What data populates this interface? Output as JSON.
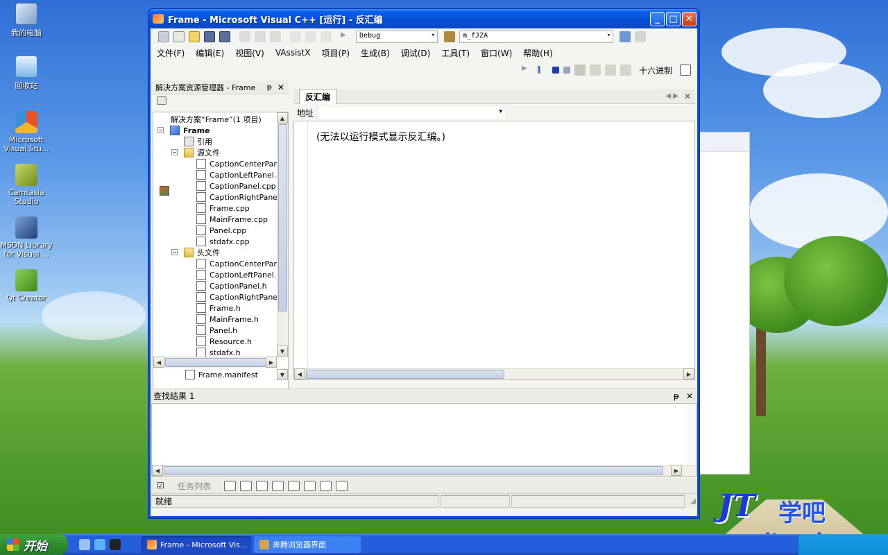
{
  "desktop": {
    "icons": [
      {
        "label": "我的电脑"
      },
      {
        "label": "回收站"
      },
      {
        "label": "Microsoft Visual Stu..."
      },
      {
        "label": "Camtasia Studio"
      },
      {
        "label": "MSDN Library for Visual ..."
      },
      {
        "label": "Qt Creator"
      }
    ]
  },
  "window": {
    "title": "Frame - Microsoft Visual C++ [运行] - 反汇编",
    "minimize": "_",
    "maximize": "□",
    "close": "✕"
  },
  "toolbar": {
    "config": "Debug",
    "find_combo": "m_fJZA",
    "hex_label": "十六进制"
  },
  "menu": [
    "文件(F)",
    "编辑(E)",
    "视图(V)",
    "VAssistX",
    "项目(P)",
    "生成(B)",
    "调试(D)",
    "工具(T)",
    "窗口(W)",
    "帮助(H)"
  ],
  "solution_explorer": {
    "title": "解决方案资源管理器 - Frame",
    "pin": "ᵽ",
    "close": "✕",
    "tree": [
      {
        "label": "解决方案“Frame”(1 项目)",
        "kind": "sol"
      },
      {
        "label": "Frame",
        "kind": "proj"
      },
      {
        "label": "引用",
        "kind": "ref"
      },
      {
        "label": "源文件",
        "kind": "folder"
      },
      {
        "label": "CaptionCenterPanel",
        "kind": "file"
      },
      {
        "label": "CaptionLeftPanel.cp",
        "kind": "file"
      },
      {
        "label": "CaptionPanel.cpp",
        "kind": "file"
      },
      {
        "label": "CaptionRightPanel.c",
        "kind": "file"
      },
      {
        "label": "Frame.cpp",
        "kind": "file"
      },
      {
        "label": "MainFrame.cpp",
        "kind": "file"
      },
      {
        "label": "Panel.cpp",
        "kind": "file"
      },
      {
        "label": "stdafx.cpp",
        "kind": "file"
      },
      {
        "label": "头文件",
        "kind": "folder"
      },
      {
        "label": "CaptionCenterPanel",
        "kind": "file"
      },
      {
        "label": "CaptionLeftPanel.h",
        "kind": "file"
      },
      {
        "label": "CaptionPanel.h",
        "kind": "file"
      },
      {
        "label": "CaptionRightPanel.h",
        "kind": "file"
      },
      {
        "label": "Frame.h",
        "kind": "file"
      },
      {
        "label": "MainFrame.h",
        "kind": "file"
      },
      {
        "label": "Panel.h",
        "kind": "file"
      },
      {
        "label": "Resource.h",
        "kind": "file"
      },
      {
        "label": "stdafx.h",
        "kind": "file"
      }
    ],
    "extra_item": "Frame.manifest"
  },
  "disasm": {
    "tab": "反汇编",
    "address_label": "地址",
    "address_value": "",
    "message": "(无法以运行模式显示反汇编。)"
  },
  "find_results": {
    "title": "查找结果 1"
  },
  "tasks": {
    "label": "任务列表"
  },
  "status": {
    "text": "就绪"
  },
  "taskbar": {
    "start": "开始",
    "buttons": [
      "Frame - Microsoft Vis...",
      "奔腾浏览器界面"
    ]
  },
  "watermark": {
    "logo": "JT",
    "cn": "学吧",
    "url": "www.itxueba.org"
  }
}
